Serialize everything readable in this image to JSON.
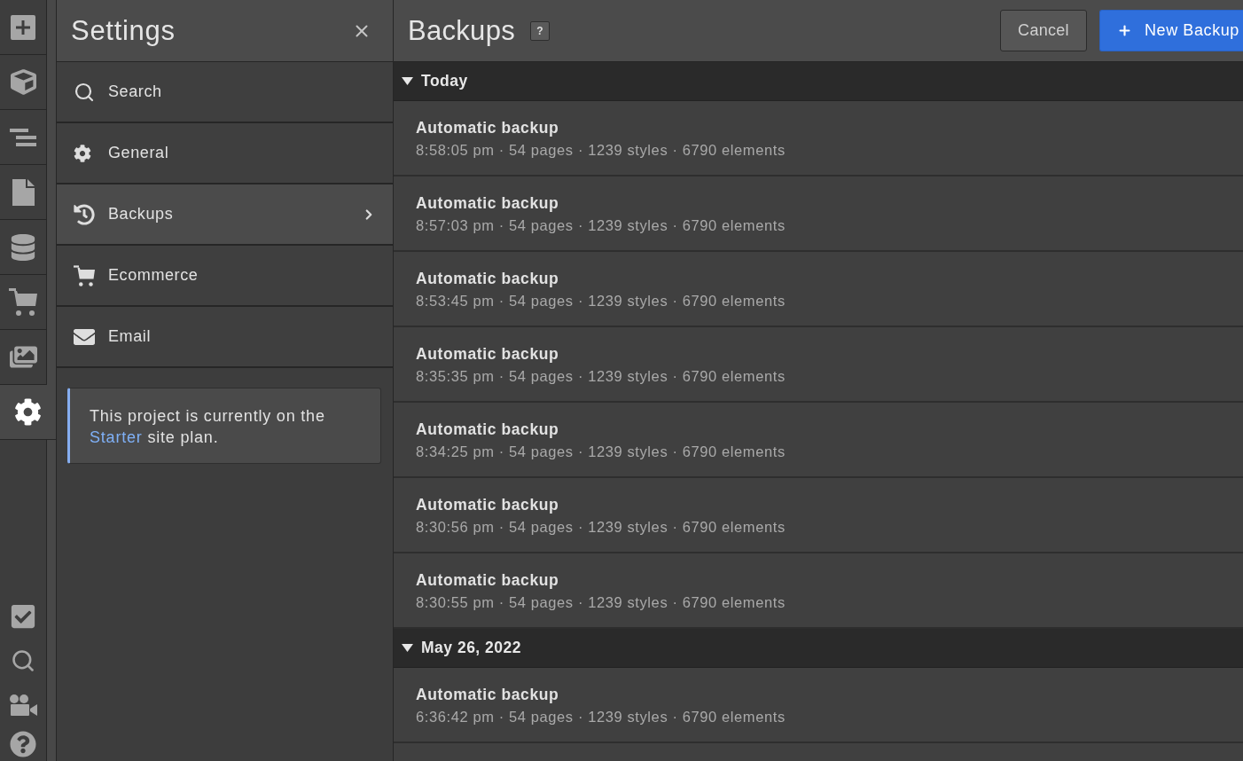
{
  "tool_bar": {
    "tools": [
      {
        "selected": false
      },
      {
        "selected": false
      },
      {
        "selected": false
      },
      {
        "selected": false
      },
      {
        "selected": false
      },
      {
        "selected": false
      },
      {
        "selected": false
      },
      {
        "selected": true
      }
    ]
  },
  "settings": {
    "title": "Settings",
    "items": [
      {
        "label": "Search",
        "selected": false
      },
      {
        "label": "General",
        "selected": false
      },
      {
        "label": "Backups",
        "selected": true
      },
      {
        "label": "Ecommerce",
        "selected": false
      },
      {
        "label": "Email",
        "selected": false
      }
    ],
    "notice": {
      "text_before": "This project is currently on the",
      "link": "Starter",
      "text_after": "site plan."
    }
  },
  "backups": {
    "title": "Backups",
    "help": "?",
    "buttons": [
      {
        "label": "Cancel",
        "kind": "secondary"
      },
      {
        "label": "New Backup",
        "kind": "primary"
      }
    ],
    "groups": [
      {
        "label": "Today",
        "expanded": true,
        "items": [
          {
            "title": "Automatic backup",
            "details": "8:58:05 pm · 54 pages · 1239 styles · 6790 elements"
          },
          {
            "title": "Automatic backup",
            "details": "8:57:03 pm · 54 pages · 1239 styles · 6790 elements"
          },
          {
            "title": "Automatic backup",
            "details": "8:53:45 pm · 54 pages · 1239 styles · 6790 elements"
          },
          {
            "title": "Automatic backup",
            "details": "8:35:35 pm · 54 pages · 1239 styles · 6790 elements"
          },
          {
            "title": "Automatic backup",
            "details": "8:34:25 pm · 54 pages · 1239 styles · 6790 elements"
          },
          {
            "title": "Automatic backup",
            "details": "8:30:56 pm · 54 pages · 1239 styles · 6790 elements"
          },
          {
            "title": "Automatic backup",
            "details": "8:30:55 pm · 54 pages · 1239 styles · 6790 elements"
          }
        ]
      },
      {
        "label": "May 26, 2022",
        "expanded": true,
        "items": [
          {
            "title": "Automatic backup",
            "details": "6:36:42 pm · 54 pages · 1239 styles · 6790 elements"
          }
        ]
      }
    ]
  }
}
